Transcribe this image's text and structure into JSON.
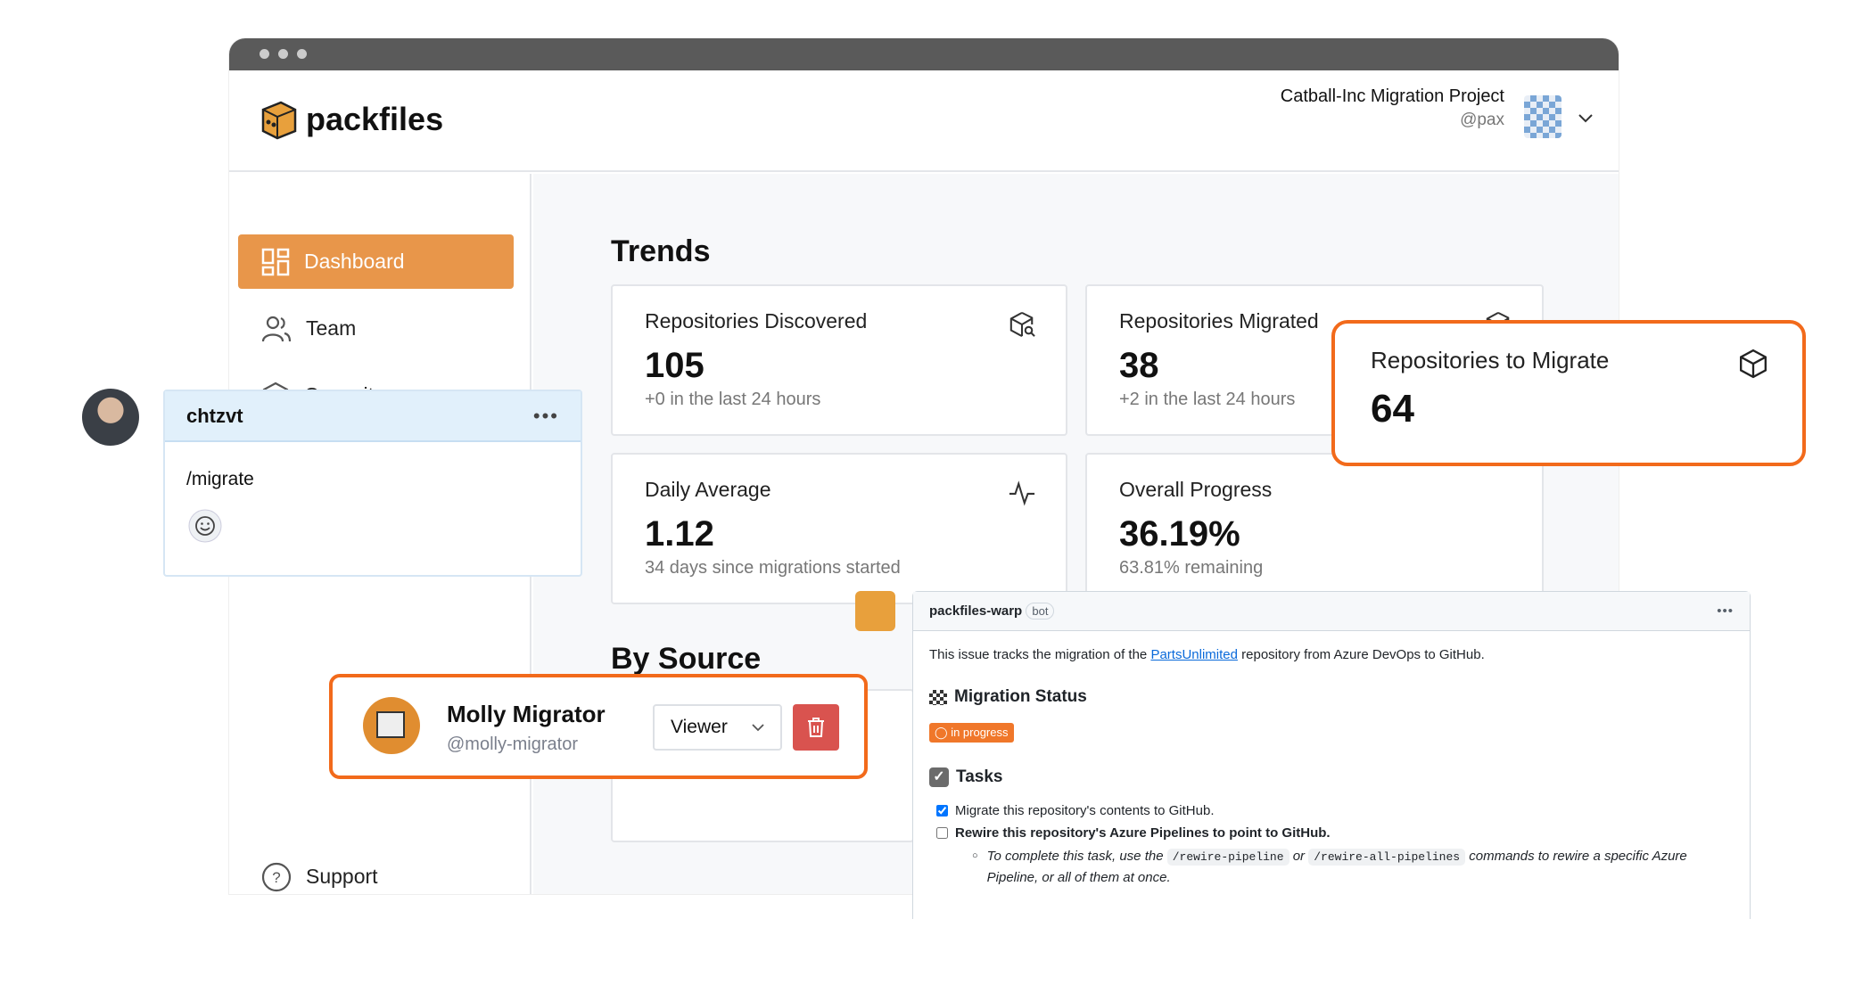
{
  "brand": {
    "name": "packfiles",
    "accent": "#e8964a",
    "highlight": "#f26a1b"
  },
  "header": {
    "project": "Catball-Inc Migration Project",
    "user": "@pax"
  },
  "sidebar": {
    "items": [
      {
        "label": "Dashboard",
        "icon": "dashboard-icon",
        "active": true
      },
      {
        "label": "Team",
        "icon": "team-icon"
      },
      {
        "label": "Capacity",
        "icon": "box-icon"
      }
    ],
    "support": "Support"
  },
  "trends": {
    "title": "Trends",
    "cards": [
      {
        "title": "Repositories Discovered",
        "value": "105",
        "sub": "+0 in the last 24 hours",
        "icon": "box-search-icon"
      },
      {
        "title": "Repositories Migrated",
        "value": "38",
        "sub": "+2 in the last 24 hours",
        "icon": "box-check-icon"
      },
      {
        "title": "Daily Average",
        "value": "1.12",
        "sub": "34 days since migrations started",
        "icon": "activity-icon"
      },
      {
        "title": "Overall Progress",
        "value": "36.19%",
        "sub": "63.81% remaining"
      }
    ]
  },
  "highlight_card": {
    "title": "Repositories to Migrate",
    "value": "64",
    "icon": "box-icon"
  },
  "by_source": {
    "title": "By Source"
  },
  "chat": {
    "user": "chtzvt",
    "message": "/migrate"
  },
  "member": {
    "name": "Molly Migrator",
    "handle": "@molly-migrator",
    "role": "Viewer"
  },
  "bot_comment": {
    "author": "packfiles-warp",
    "badge": "bot",
    "intro_pre": "This issue tracks the migration of the ",
    "intro_link": "PartsUnlimited",
    "intro_post": " repository from Azure DevOps to GitHub.",
    "status_heading": "Migration Status",
    "status_badge": "in progress",
    "tasks_heading": "Tasks",
    "tasks": [
      {
        "label": "Migrate this repository's contents to GitHub.",
        "checked": true
      },
      {
        "label": "Rewire this repository's Azure Pipelines to point to GitHub.",
        "checked": false
      }
    ],
    "note_pre": "To complete this task, use the ",
    "code1": "/rewire-pipeline",
    "note_mid": " or ",
    "code2": "/rewire-all-pipelines",
    "note_post": " commands to rewire a specific Azure Pipeline, or all of them at once."
  }
}
